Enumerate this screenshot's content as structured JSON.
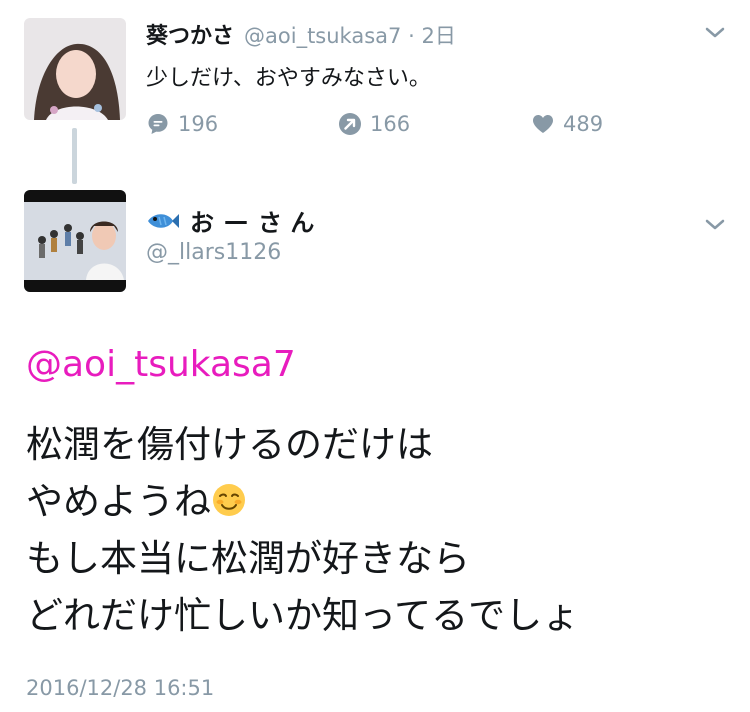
{
  "tweet1": {
    "display_name": "葵つかさ",
    "handle": "@aoi_tsukasa7",
    "separator": "·",
    "time": "2日",
    "text": "少しだけ、おやすみなさい。",
    "actions": {
      "reply_count": "196",
      "retweet_count": "166",
      "like_count": "489"
    },
    "avatar_icon": "profile-photo",
    "menu_icon": "chevron-down-icon"
  },
  "tweet2": {
    "display_name": "おーさん",
    "display_name_parts": {
      "prefix": "お",
      "dash": "—",
      "suffix": "さ ん"
    },
    "name_emoji": "fish-emoji",
    "handle": "@_llars1126",
    "avatar_icon": "profile-photo",
    "menu_icon": "chevron-down-icon",
    "mention": "@aoi_tsukasa7",
    "body_lines": [
      "松潤を傷付けるのだけは",
      "やめようね",
      "もし本当に松潤が好きなら",
      "どれだけ忙しいか知ってるでしょ"
    ],
    "body_emoji": "smiling-face-emoji",
    "timestamp": "2016/12/28 16:51"
  },
  "colors": {
    "mention": "#e81cbe",
    "secondary_text": "#8899a6",
    "thread_line": "#cbd5dc"
  }
}
